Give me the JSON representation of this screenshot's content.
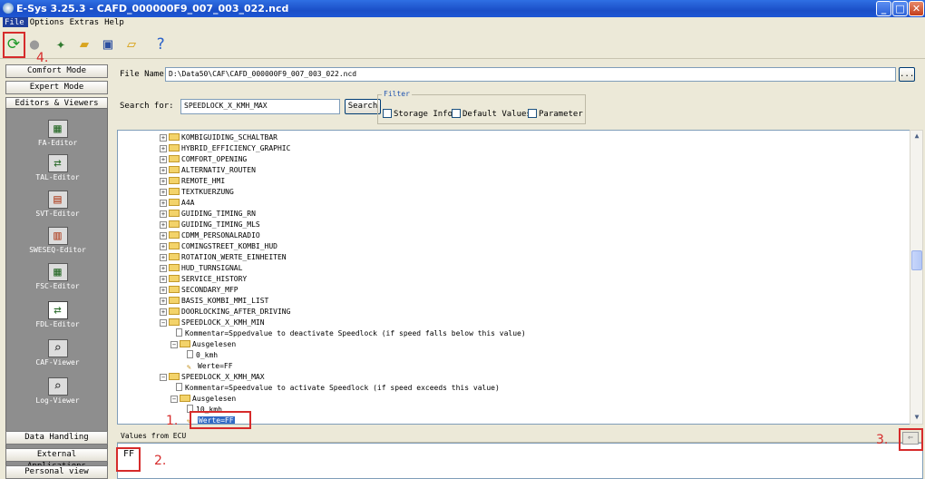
{
  "window": {
    "title": "E-Sys 3.25.3 - CAFD_000000F9_007_003_022.ncd"
  },
  "menu": [
    "File",
    "Options",
    "Extras",
    "Help"
  ],
  "toolbar": {
    "icons": [
      "connect-icon",
      "disconnect-icon",
      "tool-icon",
      "open-folder-icon",
      "save-icon",
      "open-file-icon",
      "help-icon"
    ]
  },
  "left": {
    "buttons": {
      "comfort": "Comfort Mode",
      "expert": "Expert Mode",
      "editors": "Editors & Viewers"
    },
    "editors": [
      {
        "label": "FA-Editor"
      },
      {
        "label": "TAL-Editor"
      },
      {
        "label": "SVT-Editor"
      },
      {
        "label": "SWESEQ-Editor"
      },
      {
        "label": "FSC-Editor"
      },
      {
        "label": "FDL-Editor"
      },
      {
        "label": "CAF-Viewer"
      },
      {
        "label": "Log-Viewer"
      }
    ],
    "bottom": {
      "data": "Data Handling",
      "external": "External Applications",
      "personal": "Personal view"
    }
  },
  "file": {
    "label": "File Name:",
    "value": "D:\\Data50\\CAF\\CAFD_000000F9_007_003_022.ncd",
    "browse": "..."
  },
  "search": {
    "label": "Search for:",
    "value": "SPEEDLOCK_X_KMH_MAX",
    "button": "Search"
  },
  "filter": {
    "legend": "Filter",
    "storage": "Storage Info",
    "default": "Default Values",
    "parameter": "Parameter"
  },
  "tree": [
    "KOMBIGUIDING_SCHALTBAR",
    "HYBRID_EFFICIENCY_GRAPHIC",
    "COMFORT_OPENING",
    "ALTERNATIV_ROUTEN",
    "REMOTE_HMI",
    "TEXTKUERZUNG",
    "A4A",
    "GUIDING_TIMING_RN",
    "GUIDING_TIMING_MLS",
    "CDMM_PERSONALRADIO",
    "COMINGSTREET_KOMBI_HUD",
    "ROTATION_WERTE_EINHEITEN",
    "HUD_TURNSIGNAL",
    "SERVICE_HISTORY",
    "SECONDARY_MFP",
    "BASIS_KOMBI_MMI_LIST",
    "DOORLOCKING_AFTER_DRIVING"
  ],
  "min_node": {
    "name": "SPEEDLOCK_X_KMH_MIN",
    "comment": "Kommentar=Sppedvalue to deactivate Speedlock (if speed falls below this value)",
    "read": "Ausgelesen",
    "unit": "0_kmh",
    "value": "Werte=FF"
  },
  "max_node": {
    "name": "SPEEDLOCK_X_KMH_MAX",
    "comment": "Kommentar=Speedvalue to activate Speedlock (if speed exceeds this value)",
    "read": "Ausgelesen",
    "unit": "10_kmh",
    "value": "Werte=FF"
  },
  "values": {
    "header": "Values from ECU",
    "value": "FF"
  },
  "annotations": {
    "n1": "1.",
    "n2": "2.",
    "n3": "3.",
    "n4": "4."
  }
}
